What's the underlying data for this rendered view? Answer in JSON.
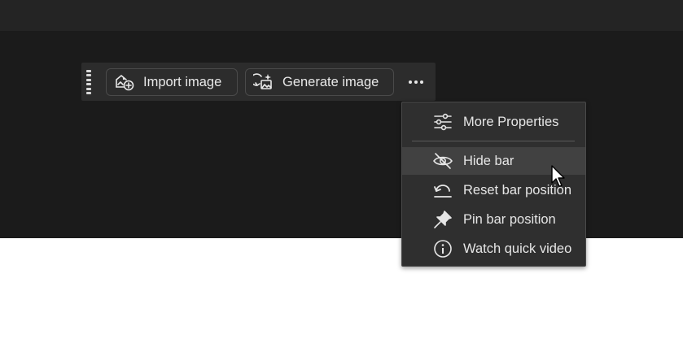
{
  "toolbar": {
    "import_label": "Import image",
    "generate_label": "Generate image",
    "import_icon": "image-add-icon",
    "generate_icon": "image-generate-icon",
    "more_icon": "more-horizontal-icon"
  },
  "menu": {
    "items": [
      {
        "label": "More Properties",
        "icon": "properties-sliders-icon"
      },
      {
        "label": "Hide bar",
        "icon": "eye-hidden-icon",
        "hovered": true
      },
      {
        "label": "Reset bar position",
        "icon": "reset-icon"
      },
      {
        "label": "Pin bar position",
        "icon": "pin-icon"
      },
      {
        "label": "Watch quick video",
        "icon": "info-icon"
      }
    ]
  },
  "colors": {
    "topbar": "#242424",
    "canvas": "#1b1b1b",
    "bar_bg": "#2c2c2c",
    "menu_bg": "#2f2f2f",
    "menu_hover": "#414141",
    "text": "#e6e6e6"
  }
}
